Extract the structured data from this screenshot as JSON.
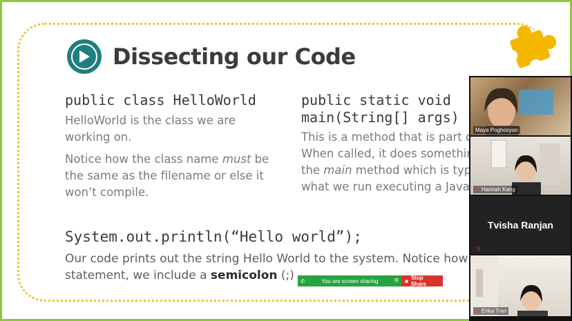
{
  "slide": {
    "title": "Dissecting our Code",
    "col1": {
      "code": "public class HelloWorld",
      "para1": "HelloWorld is the class we are working on.",
      "para2_pre": "Notice how the class name ",
      "para2_em": "must",
      "para2_post": " be the same as the filename or else it won’t compile."
    },
    "col2": {
      "code_line1": "public static void",
      "code_line2": "main(String[] args)",
      "para_pre": "This is a method that is part of class. When called, it does something. This is the ",
      "para_em": "main",
      "para_post": " method which is typically what we run executing a Java program."
    },
    "bottom": {
      "code": "System.out.println(“Hello world”);",
      "para_pre": "Our code prints out the string Hello World to the system. Notice how at the statement, we include a ",
      "para_bold": "semicolon",
      "para_post": " (;)"
    }
  },
  "share_bar": {
    "status": "You are screen sharing",
    "stop_label": "Stop Share"
  },
  "participants": [
    {
      "name": "Maya Poghosyan",
      "muted": false,
      "video": true
    },
    {
      "name": "Hannah Kang",
      "muted": true,
      "video": true
    },
    {
      "name": "Tvisha Ranjan",
      "muted": true,
      "video": false
    },
    {
      "name": "Erika Tran",
      "muted": false,
      "video": true
    }
  ],
  "colors": {
    "frame_green": "#8dc63f",
    "accent_teal": "#1f7f7f",
    "puzzle_yellow": "#f5b800",
    "dotted_yellow": "#f0c22e",
    "share_green": "#27a33f",
    "stop_red": "#d9342b"
  }
}
